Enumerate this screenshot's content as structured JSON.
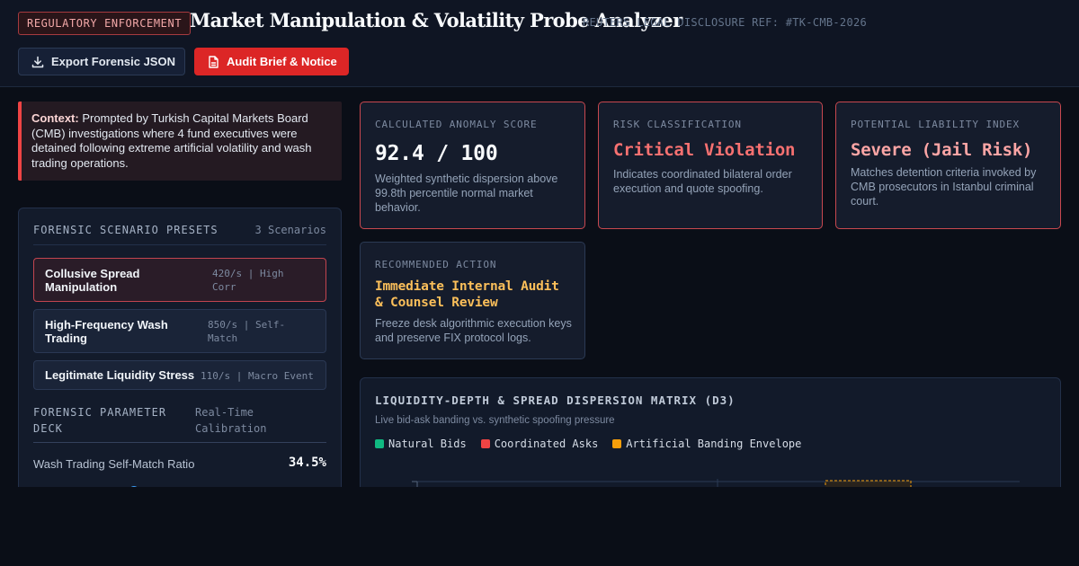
{
  "header": {
    "badge": "REGULATORY ENFORCEMENT",
    "title": "Market Manipulation & Volatility Probe Analyzer",
    "reference": "REUTERS LEGAL DISCLOSURE REF: #TK-CMB-2026",
    "export_label": "Export Forensic JSON",
    "audit_label": "Audit Brief & Notice"
  },
  "context": {
    "lead": "Context:",
    "text": " Prompted by Turkish Capital Markets Board (CMB) investigations where 4 fund executives were detained following extreme artificial volatility and wash trading operations."
  },
  "presets": {
    "heading": "FORENSIC SCENARIO PRESETS",
    "count": "3 Scenarios",
    "items": [
      {
        "name": "Collusive Spread Manipulation",
        "meta": "420/s | High Corr",
        "active": true
      },
      {
        "name": "High-Frequency Wash Trading",
        "meta": "850/s | Self-Match",
        "active": false
      },
      {
        "name": "Legitimate Liquidity Stress",
        "meta": "110/s | Macro Event",
        "active": false
      }
    ]
  },
  "deck": {
    "title": "FORENSIC PARAMETER DECK",
    "subtitle": "Real-Time Calibration",
    "param_label": "Wash Trading Self-Match Ratio",
    "param_value": "34.5%",
    "param_fraction": 0.345
  },
  "metrics": {
    "anomaly": {
      "label": "CALCULATED ANOMALY SCORE",
      "value": "92.4 / 100",
      "desc": "Weighted synthetic dispersion above 99.8th percentile normal market behavior."
    },
    "risk": {
      "label": "RISK CLASSIFICATION",
      "value": "Critical Violation",
      "desc": "Indicates coordinated bilateral order execution and quote spoofing."
    },
    "liability": {
      "label": "POTENTIAL LIABILITY INDEX",
      "value": "Severe (Jail Risk)",
      "desc": "Matches detention criteria invoked by CMB prosecutors in Istanbul criminal court."
    },
    "action": {
      "label": "RECOMMENDED ACTION",
      "value": "Immediate Internal Audit & Counsel Review",
      "desc": "Freeze desk algorithmic execution keys and preserve FIX protocol logs."
    }
  },
  "chart": {
    "title": "LIQUIDITY-DEPTH & SPREAD DISPERSION MATRIX (D3)",
    "subtitle": "Live bid-ask banding vs. synthetic spoofing pressure",
    "legend": [
      {
        "name": "Natural Bids",
        "color": "#10b981"
      },
      {
        "name": "Coordinated Asks",
        "color": "#ef4444"
      },
      {
        "name": "Artificial Banding Envelope",
        "color": "#f59e0b"
      }
    ]
  },
  "colors": {
    "accent_red": "#dc2626",
    "critical": "#f87171",
    "severe": "#fca5a5",
    "action": "#fbbf5a",
    "score": "#f8fafc"
  }
}
